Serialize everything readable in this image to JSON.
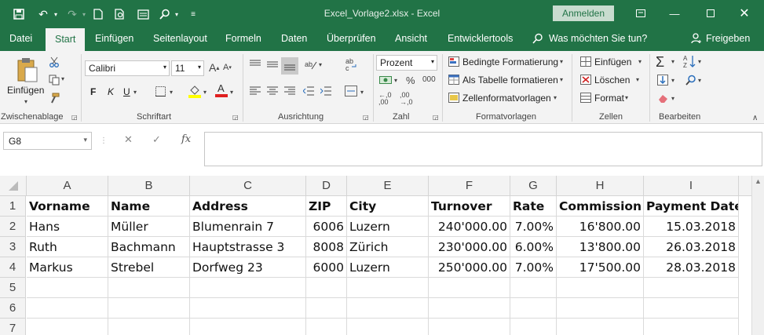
{
  "title_bar": {
    "doc_title": "Excel_Vorlage2.xlsx  -  Excel",
    "signin": "Anmelden"
  },
  "tabs": [
    "Datei",
    "Start",
    "Einfügen",
    "Seitenlayout",
    "Formeln",
    "Daten",
    "Überprüfen",
    "Ansicht",
    "Entwicklertools"
  ],
  "tell_me": "Was möchten Sie tun?",
  "share": "Freigeben",
  "ribbon": {
    "clipboard": {
      "paste": "Einfügen",
      "label": "Zwischenablage"
    },
    "font": {
      "name": "Calibri",
      "size": "11",
      "bold": "F",
      "italic": "K",
      "underline": "U",
      "label": "Schriftart"
    },
    "alignment": {
      "label": "Ausrichtung"
    },
    "number": {
      "format": "Prozent",
      "label": "Zahl"
    },
    "styles": {
      "conditional": "Bedingte Formatierung",
      "as_table": "Als Tabelle formatieren",
      "cell_styles": "Zellenformatvorlagen",
      "label": "Formatvorlagen"
    },
    "cells": {
      "insert": "Einfügen",
      "delete": "Löschen",
      "format": "Format",
      "label": "Zellen"
    },
    "editing": {
      "label": "Bearbeiten"
    }
  },
  "formula_bar": {
    "name_box": "G8",
    "formula": ""
  },
  "sheet": {
    "columns": [
      "A",
      "B",
      "C",
      "D",
      "E",
      "F",
      "G",
      "H",
      "I"
    ],
    "row_numbers": [
      "1",
      "2",
      "3",
      "4",
      "5",
      "6",
      "7"
    ],
    "header": [
      "Vorname",
      "Name",
      "Address",
      "ZIP",
      "City",
      "Turnover",
      "Rate",
      "Commission",
      "Payment Date"
    ],
    "rows": [
      [
        "Hans",
        "Müller",
        "Blumenrain 7",
        "6006",
        "Luzern",
        "240'000.00",
        "7.00%",
        "16'800.00",
        "15.03.2018"
      ],
      [
        "Ruth",
        "Bachmann",
        "Hauptstrasse 3",
        "8008",
        "Zürich",
        "230'000.00",
        "6.00%",
        "13'800.00",
        "26.03.2018"
      ],
      [
        "Markus",
        "Strebel",
        "Dorfweg 23",
        "6000",
        "Luzern",
        "250'000.00",
        "7.00%",
        "17'500.00",
        "28.03.2018"
      ]
    ]
  }
}
